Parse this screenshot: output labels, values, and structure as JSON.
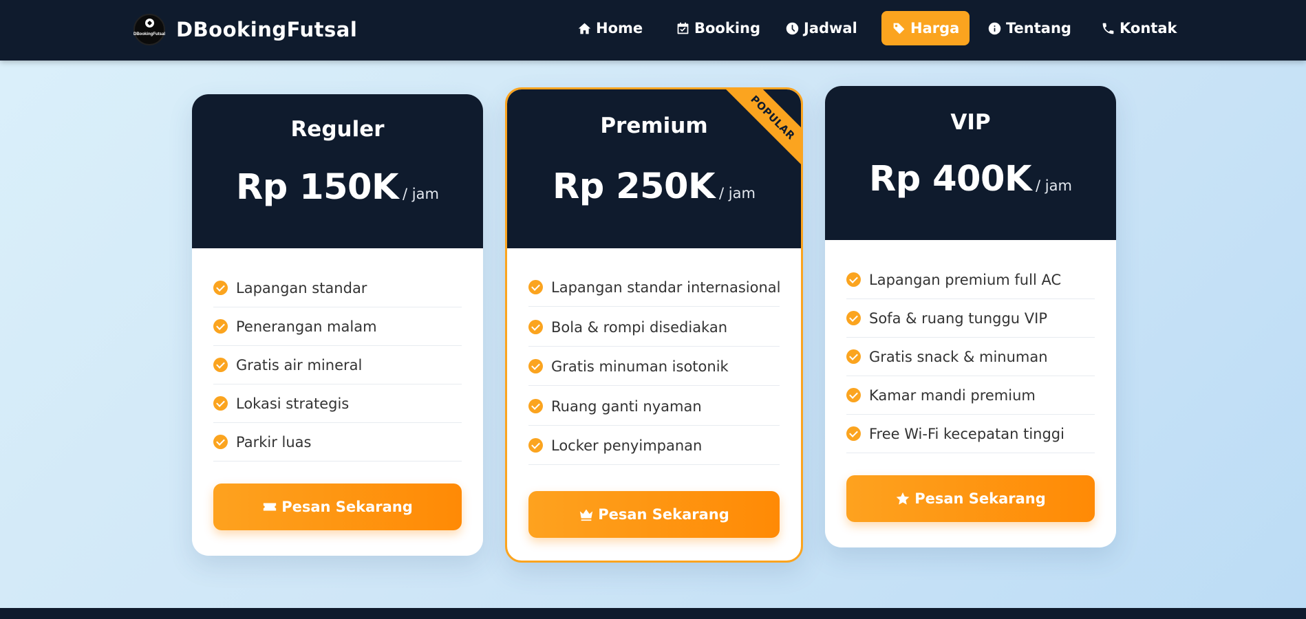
{
  "brand": {
    "name": "DBookingFutsal",
    "logo_text": "DBookingFutsal"
  },
  "nav": [
    {
      "label": "Home",
      "icon": "home-icon"
    },
    {
      "label": "Booking",
      "icon": "calendar-check-icon"
    },
    {
      "label": "Jadwal",
      "icon": "clock-icon"
    },
    {
      "label": "Harga",
      "icon": "tag-icon",
      "active": true
    },
    {
      "label": "Tentang",
      "icon": "info-icon"
    },
    {
      "label": "Kontak",
      "icon": "phone-icon"
    }
  ],
  "colors": {
    "accent": "#fba41f",
    "dark": "#0f1b2d",
    "button_end": "#ff8a05"
  },
  "plans": [
    {
      "title": "Reguler",
      "price": "Rp 150K",
      "unit": "/ jam",
      "features": [
        "Lapangan standar",
        "Penerangan malam",
        "Gratis air mineral",
        "Lokasi strategis",
        "Parkir luas"
      ],
      "button": "Pesan Sekarang",
      "button_icon": "ticket-icon"
    },
    {
      "title": "Premium",
      "price": "Rp 250K",
      "unit": "/ jam",
      "badge": "POPULAR",
      "features": [
        "Lapangan standar internasional",
        "Bola & rompi disediakan",
        "Gratis minuman isotonik",
        "Ruang ganti nyaman",
        "Locker penyimpanan"
      ],
      "button": "Pesan Sekarang",
      "button_icon": "crown-icon"
    },
    {
      "title": "VIP",
      "price": "Rp 400K",
      "unit": "/ jam",
      "features": [
        "Lapangan premium full AC",
        "Sofa & ruang tunggu VIP",
        "Gratis snack & minuman",
        "Kamar mandi premium",
        "Free Wi-Fi kecepatan tinggi"
      ],
      "button": "Pesan Sekarang",
      "button_icon": "star-icon"
    }
  ]
}
